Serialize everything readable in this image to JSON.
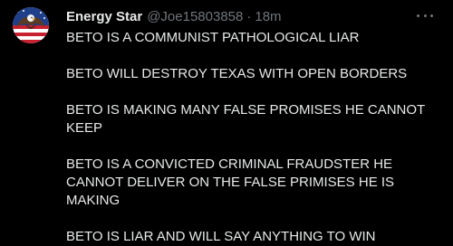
{
  "tweet": {
    "display_name": "Energy Star",
    "handle": "@Joe15803858",
    "separator": "·",
    "time": "18m",
    "paragraphs": [
      "BETO IS A COMMUNIST PATHOLOGICAL LIAR",
      "BETO WILL DESTROY TEXAS WITH OPEN BORDERS",
      "BETO IS MAKING MANY FALSE PROMISES HE CANNOT KEEP",
      "BETO IS A CONVICTED CRIMINAL FRAUDSTER HE CANNOT DELIVER ON THE FALSE PRIMISES HE IS MAKING",
      "BETO IS LIAR AND WILL SAY ANYTHING TO WIN"
    ]
  },
  "icons": {
    "more": "more-horizontal-icon",
    "avatar": "avatar-eagle-flag"
  },
  "colors": {
    "background": "#000000",
    "primary_text": "#e7e9ea",
    "secondary_text": "#71767b"
  }
}
